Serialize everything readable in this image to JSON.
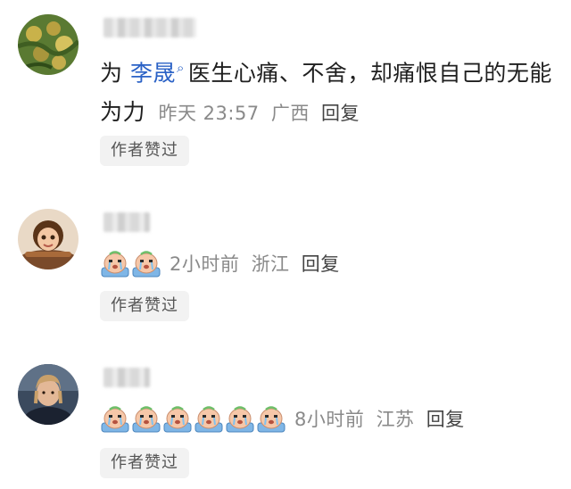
{
  "comments": [
    {
      "avatar_icon": "plant-photo-avatar",
      "mention": "李晟",
      "text_before": "为 ",
      "text_after": "医生心痛、不舍，却痛恨自己的无能为力",
      "time": "昨天 23:57",
      "location": "广西",
      "reply": "回复",
      "badge": "作者赞过"
    },
    {
      "avatar_icon": "cartoon-girl-avatar",
      "emoji_count": 2,
      "emoji_name": "crying-face-emoji",
      "time": "2小时前",
      "location": "浙江",
      "reply": "回复",
      "badge": "作者赞过"
    },
    {
      "avatar_icon": "man-photo-avatar",
      "emoji_count": 6,
      "emoji_name": "crying-face-emoji",
      "time": "8小时前",
      "location": "江苏",
      "reply": "回复",
      "badge": "作者赞过"
    }
  ]
}
